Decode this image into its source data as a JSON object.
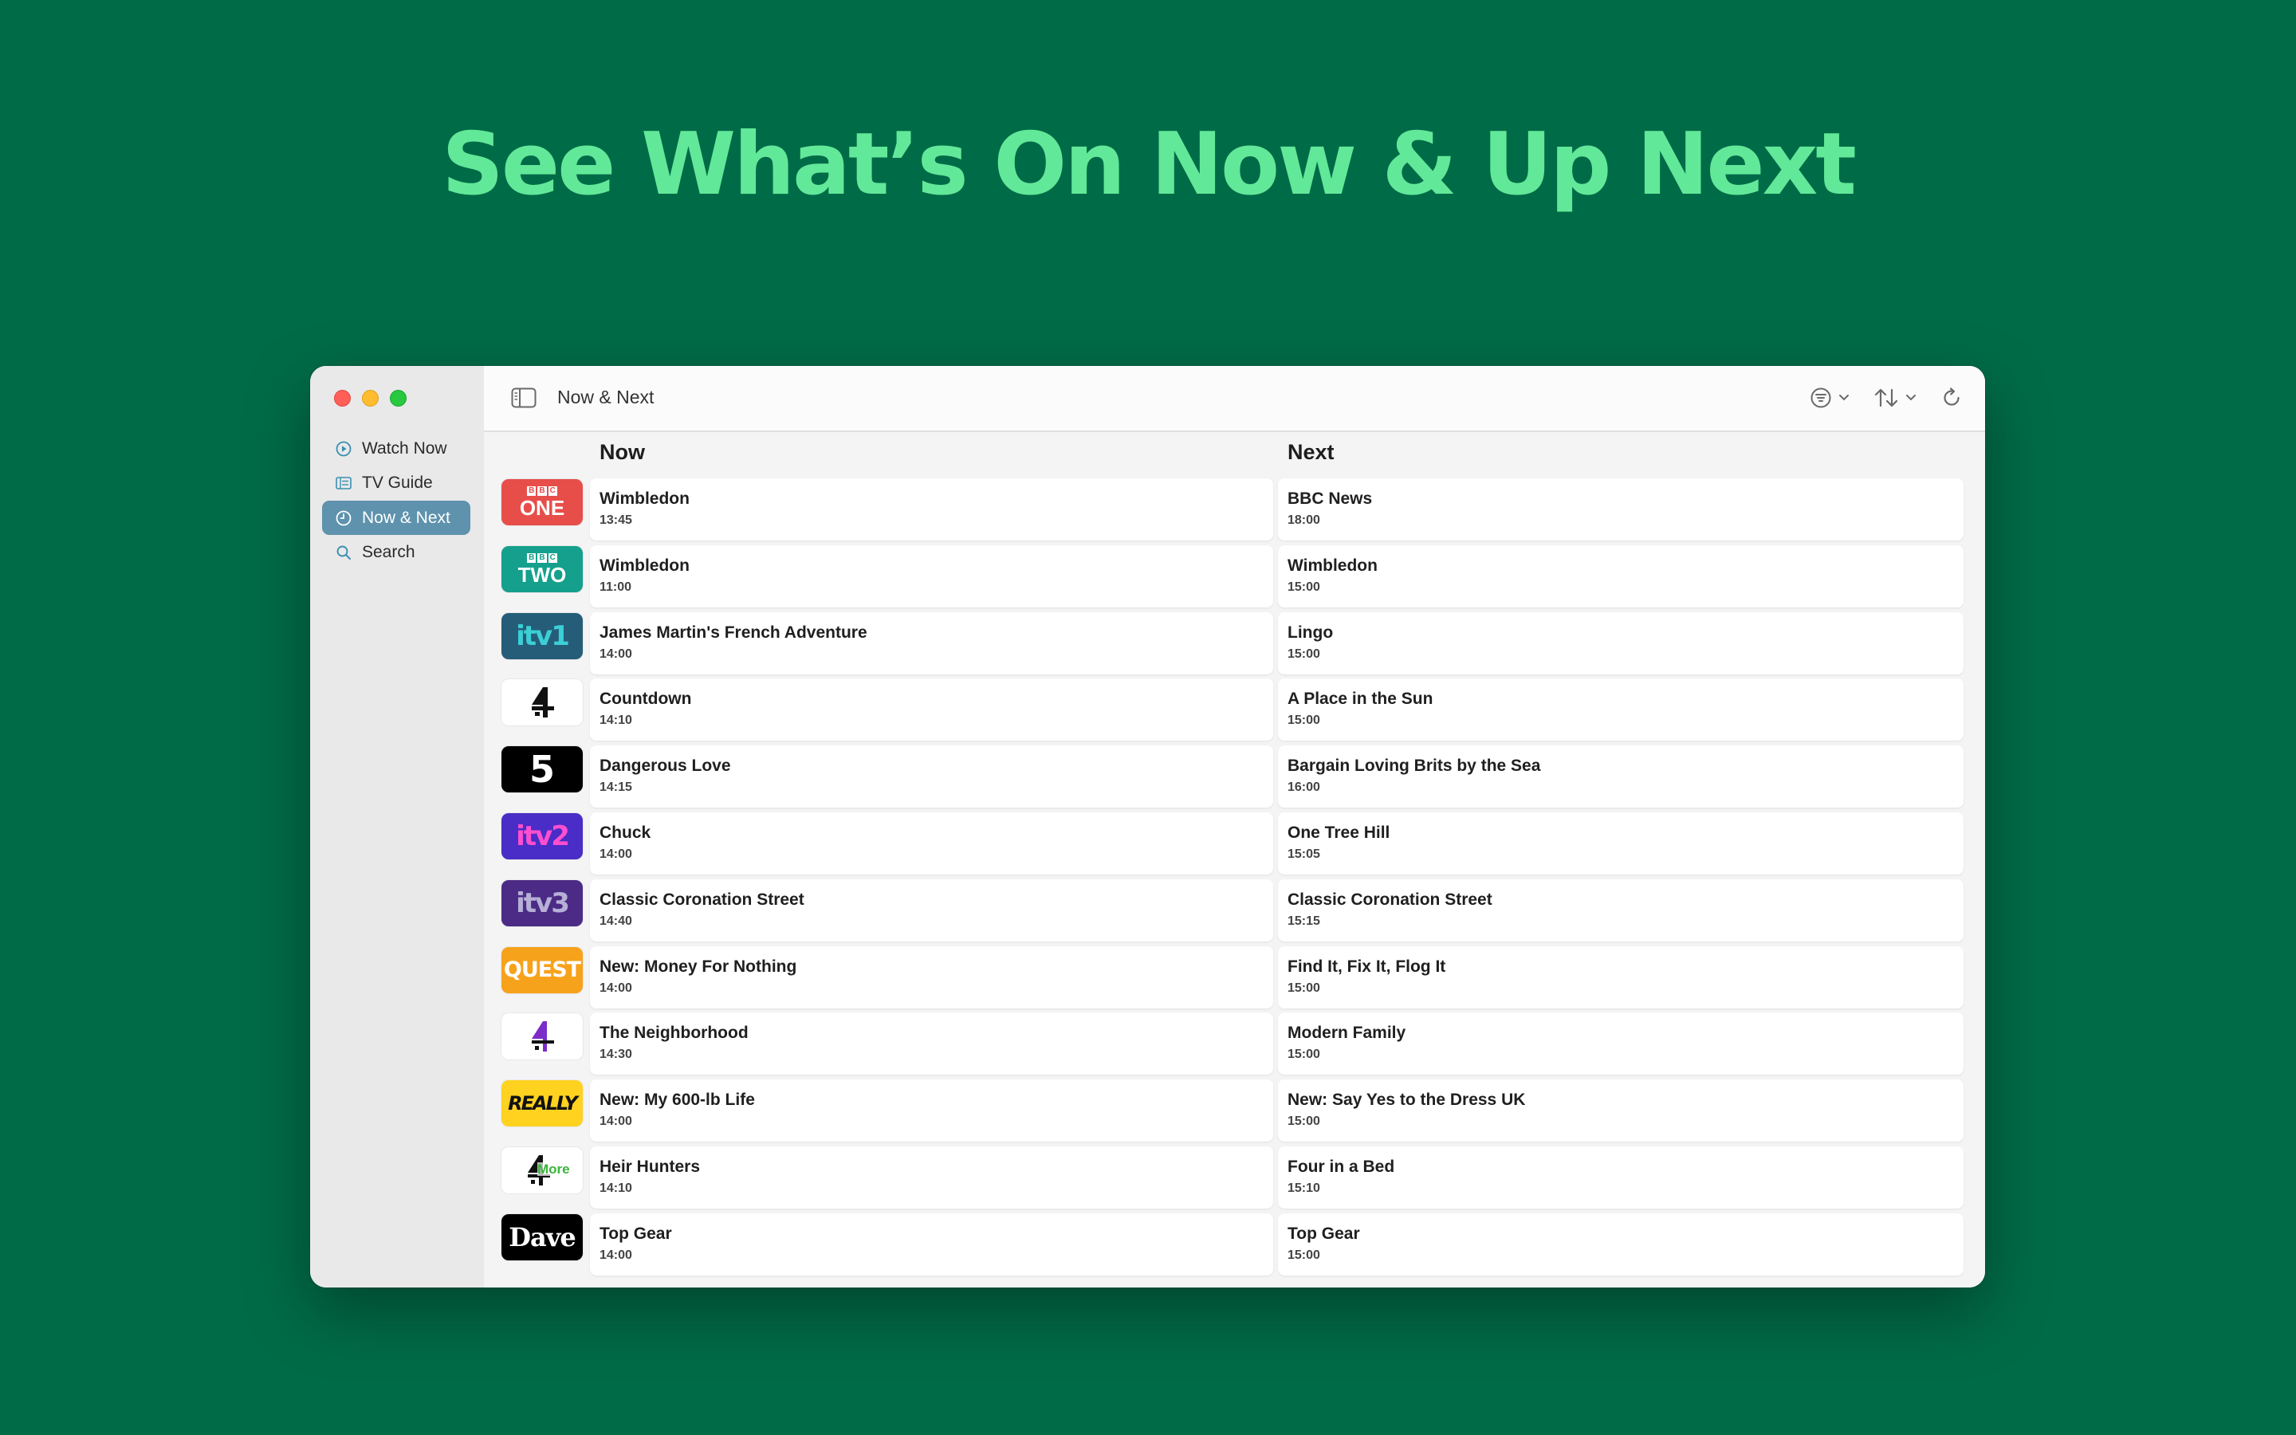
{
  "headline": "See What’s On Now & Up Next",
  "sidebar": {
    "items": [
      {
        "label": "Watch Now",
        "icon": "play-circle-icon"
      },
      {
        "label": "TV Guide",
        "icon": "list-icon"
      },
      {
        "label": "Now & Next",
        "icon": "clock-icon",
        "active": true
      },
      {
        "label": "Search",
        "icon": "search-icon"
      }
    ]
  },
  "toolbar": {
    "title": "Now & Next"
  },
  "columns": {
    "now": "Now",
    "next": "Next"
  },
  "channels": [
    {
      "logo": {
        "top": "BBC",
        "main": "ONE",
        "bg": "#e74e4a"
      },
      "now": {
        "title": "Wimbledon",
        "time": "13:45"
      },
      "next": {
        "title": "BBC News",
        "time": "18:00"
      }
    },
    {
      "logo": {
        "top": "BBC",
        "main": "TWO",
        "bg": "#14a08c"
      },
      "now": {
        "title": "Wimbledon",
        "time": "11:00"
      },
      "next": {
        "title": "Wimbledon",
        "time": "15:00"
      }
    },
    {
      "logo": {
        "main": "itv1",
        "bg": "#255d78",
        "fg": "#3ccfd6"
      },
      "now": {
        "title": "James Martin's French Adventure",
        "time": "14:00"
      },
      "next": {
        "title": "Lingo",
        "time": "15:00"
      }
    },
    {
      "logo": {
        "main": "4",
        "bg": "#ffffff",
        "fg": "#111111"
      },
      "now": {
        "title": "Countdown",
        "time": "14:10"
      },
      "next": {
        "title": "A Place in the Sun",
        "time": "15:00"
      }
    },
    {
      "logo": {
        "main": "5",
        "bg": "#000000",
        "fg": "#ffffff"
      },
      "now": {
        "title": "Dangerous Love",
        "time": "14:15"
      },
      "next": {
        "title": "Bargain Loving Brits by the Sea",
        "time": "16:00"
      }
    },
    {
      "logo": {
        "main": "itv2",
        "bg": "#4a2cc6",
        "fg": "#ff4fd0"
      },
      "now": {
        "title": "Chuck",
        "time": "14:00"
      },
      "next": {
        "title": "One Tree Hill",
        "time": "15:05"
      }
    },
    {
      "logo": {
        "main": "itv3",
        "bg": "#4b2b86",
        "fg": "#b7b0d6"
      },
      "now": {
        "title": "Classic Coronation Street",
        "time": "14:40"
      },
      "next": {
        "title": "Classic Coronation Street",
        "time": "15:15"
      }
    },
    {
      "logo": {
        "main": "QUEST",
        "bg": "#f7a21b",
        "fg": "#ffffff"
      },
      "now": {
        "title": "New: Money For Nothing",
        "time": "14:00"
      },
      "next": {
        "title": "Find It, Fix It, Flog It",
        "time": "15:00"
      }
    },
    {
      "logo": {
        "main": "E4",
        "bg": "#ffffff",
        "fg": "#7b2cc9"
      },
      "now": {
        "title": "The Neighborhood",
        "time": "14:30"
      },
      "next": {
        "title": "Modern Family",
        "time": "15:00"
      }
    },
    {
      "logo": {
        "main": "REALLY",
        "bg": "#ffd21f",
        "fg": "#111111"
      },
      "now": {
        "title": "New: My 600-lb Life",
        "time": "14:00"
      },
      "next": {
        "title": "New: Say Yes to the Dress UK",
        "time": "15:00"
      }
    },
    {
      "logo": {
        "main": "More",
        "bg": "#ffffff",
        "fg": "#3cb43c"
      },
      "now": {
        "title": "Heir Hunters",
        "time": "14:10"
      },
      "next": {
        "title": "Four in a Bed",
        "time": "15:10"
      }
    },
    {
      "logo": {
        "main": "Dave",
        "bg": "#000000",
        "fg": "#ffffff"
      },
      "now": {
        "title": "Top Gear",
        "time": "14:00"
      },
      "next": {
        "title": "Top Gear",
        "time": "15:00"
      }
    }
  ]
}
